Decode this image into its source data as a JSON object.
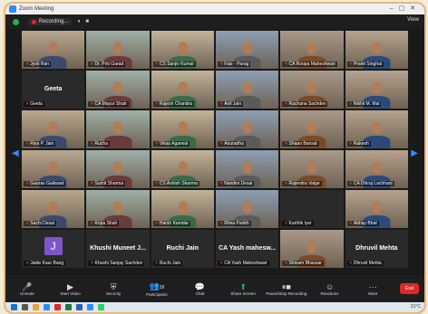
{
  "window": {
    "title": "Zoom Meeting"
  },
  "topbar": {
    "recording_label": "Recording...",
    "pause_symbol": "⏸",
    "stop_symbol": "■",
    "view_label": "View"
  },
  "participants": [
    {
      "name": "Jyoti Ran",
      "muted": true,
      "video": true
    },
    {
      "name": "Dr. Priti Garad",
      "muted": true,
      "video": true
    },
    {
      "name": "CS Sanjiv Kumar",
      "muted": true,
      "video": true
    },
    {
      "name": "Faiz - Parag",
      "muted": true,
      "video": true
    },
    {
      "name": "CA Roopa Maheshwari",
      "muted": true,
      "video": true
    },
    {
      "name": "Pranit Singhal",
      "muted": true,
      "video": true
    },
    {
      "name": "Geeta",
      "muted": true,
      "video": false,
      "big": "Geeta"
    },
    {
      "name": "CA Mayur Shah",
      "muted": true,
      "video": true
    },
    {
      "name": "Rajesh Chandra",
      "muted": true,
      "video": true
    },
    {
      "name": "Anil Jain",
      "muted": true,
      "video": true
    },
    {
      "name": "Rachana Sachdev",
      "muted": true,
      "video": true
    },
    {
      "name": "Nikhil M. Mal",
      "muted": true,
      "video": true
    },
    {
      "name": "Riya P. Jain",
      "muted": true,
      "video": true
    },
    {
      "name": "Rucha",
      "muted": true,
      "video": true
    },
    {
      "name": "Vikas Agarwal",
      "muted": true,
      "video": true
    },
    {
      "name": "Anuradha",
      "muted": true,
      "video": true
    },
    {
      "name": "Shaan Bansal",
      "muted": true,
      "video": true
    },
    {
      "name": "Rakesh",
      "muted": true,
      "video": true
    },
    {
      "name": "Gaurav Gaikwad",
      "muted": true,
      "video": true
    },
    {
      "name": "Sumit Sharma",
      "muted": true,
      "video": true
    },
    {
      "name": "CS Ashish Sharma",
      "muted": true,
      "video": true
    },
    {
      "name": "Nandini Desai",
      "muted": true,
      "video": true
    },
    {
      "name": "Rajendra Valge",
      "muted": true,
      "video": true
    },
    {
      "name": "CA Dhiraj Lachhani",
      "muted": true,
      "video": true
    },
    {
      "name": "Sachi Desai",
      "muted": true,
      "video": true
    },
    {
      "name": "Kripa Shah",
      "muted": true,
      "video": true
    },
    {
      "name": "Harsh Kamdar",
      "muted": true,
      "video": true
    },
    {
      "name": "Rhea Parikh",
      "muted": true,
      "video": true
    },
    {
      "name": "Karthik Iyer",
      "muted": true,
      "video": false
    },
    {
      "name": "Abhay Bhat",
      "muted": true,
      "video": true
    },
    {
      "name": "Jaide Kaur Bang",
      "muted": true,
      "video": false,
      "avatar": "J"
    },
    {
      "name": "Khushi Sanjay Sachdev",
      "muted": true,
      "video": false,
      "big": "Khushi Muneet J..."
    },
    {
      "name": "Ruchi Jain",
      "muted": true,
      "video": false,
      "big": "Ruchi Jain"
    },
    {
      "name": "CA Yash Maheshwari",
      "muted": true,
      "video": false,
      "big": "CA Yash mahesw..."
    },
    {
      "name": "Shivam Bhavsar",
      "muted": true,
      "video": true
    },
    {
      "name": "Dhruvil Mehta",
      "muted": true,
      "video": false,
      "big": "Dhruvil Mehta"
    }
  ],
  "toolbar": {
    "unmute": "Unmute",
    "start_video": "Start Video",
    "security": "Security",
    "participants": "Participants",
    "participants_count": "38",
    "chat": "Chat",
    "share_screen": "Share Screen",
    "pause_recording": "Pause/Stop Recording",
    "reactions": "Reactions",
    "more": "More",
    "end": "End"
  },
  "taskbar": {
    "clock": "21°C"
  },
  "colors": {
    "accent": "#2d8cff",
    "end": "#e02828",
    "share": "#23b34a"
  }
}
